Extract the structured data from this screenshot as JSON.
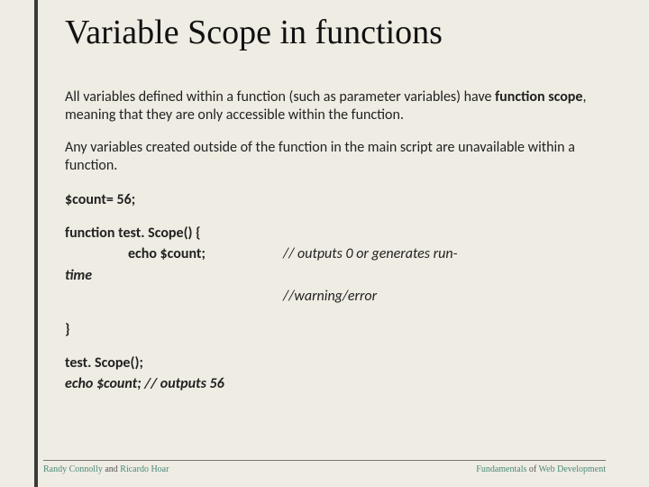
{
  "title": "Variable Scope in functions",
  "para1": {
    "pre": "All variables defined within a function (such as parameter variables) have ",
    "bold": "function scope",
    "post": ", meaning that they are only accessible within the function."
  },
  "para2": "Any variables created outside of the function in the main script are unavailable within a function.",
  "code": {
    "line1": "$count= 56;",
    "line2": "function test. Scope() {",
    "line3_indent": "echo $count;",
    "line3_comment": "// outputs 0 or generates run-",
    "line4_left": "time",
    "line4_comment": "//warning/error",
    "line5": "}",
    "line6": "test. Scope();",
    "line7": "echo $count; // outputs 56"
  },
  "footer": {
    "left": {
      "a1": "Randy Connolly",
      "mid": " and ",
      "a2": "Ricardo Hoar"
    },
    "right": {
      "a1": "Fundamentals",
      "mid": " of ",
      "a2": "Web Development"
    }
  }
}
